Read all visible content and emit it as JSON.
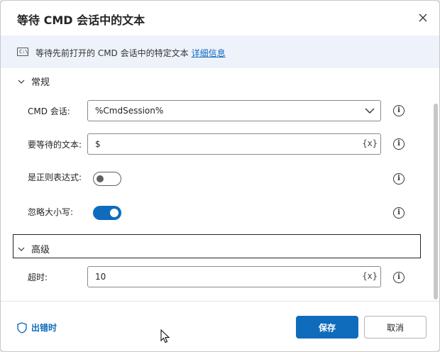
{
  "dialog": {
    "title": "等待 CMD 会话中的文本",
    "info_text": "等待先前打开的 CMD 会话中的特定文本",
    "info_link": "详细信息",
    "cmd_icon_text": "C:\\"
  },
  "general": {
    "heading": "常规",
    "cmd_session_label": "CMD 会话:",
    "cmd_session_value": "%CmdSession%",
    "wait_text_label": "要等待的文本:",
    "wait_text_value": "$",
    "var_button": "{x}",
    "regex_label": "是正则表达式:",
    "regex_enabled": false,
    "ignore_case_label": "忽略大小写:",
    "ignore_case_enabled": true
  },
  "advanced": {
    "heading": "高级",
    "timeout_label": "超时:",
    "timeout_value": "10",
    "var_button": "{x}"
  },
  "footer": {
    "on_error": "出错时",
    "save": "保存",
    "cancel": "取消"
  },
  "colors": {
    "accent": "#0f6cbd",
    "info_bar": "#eef2fb"
  }
}
